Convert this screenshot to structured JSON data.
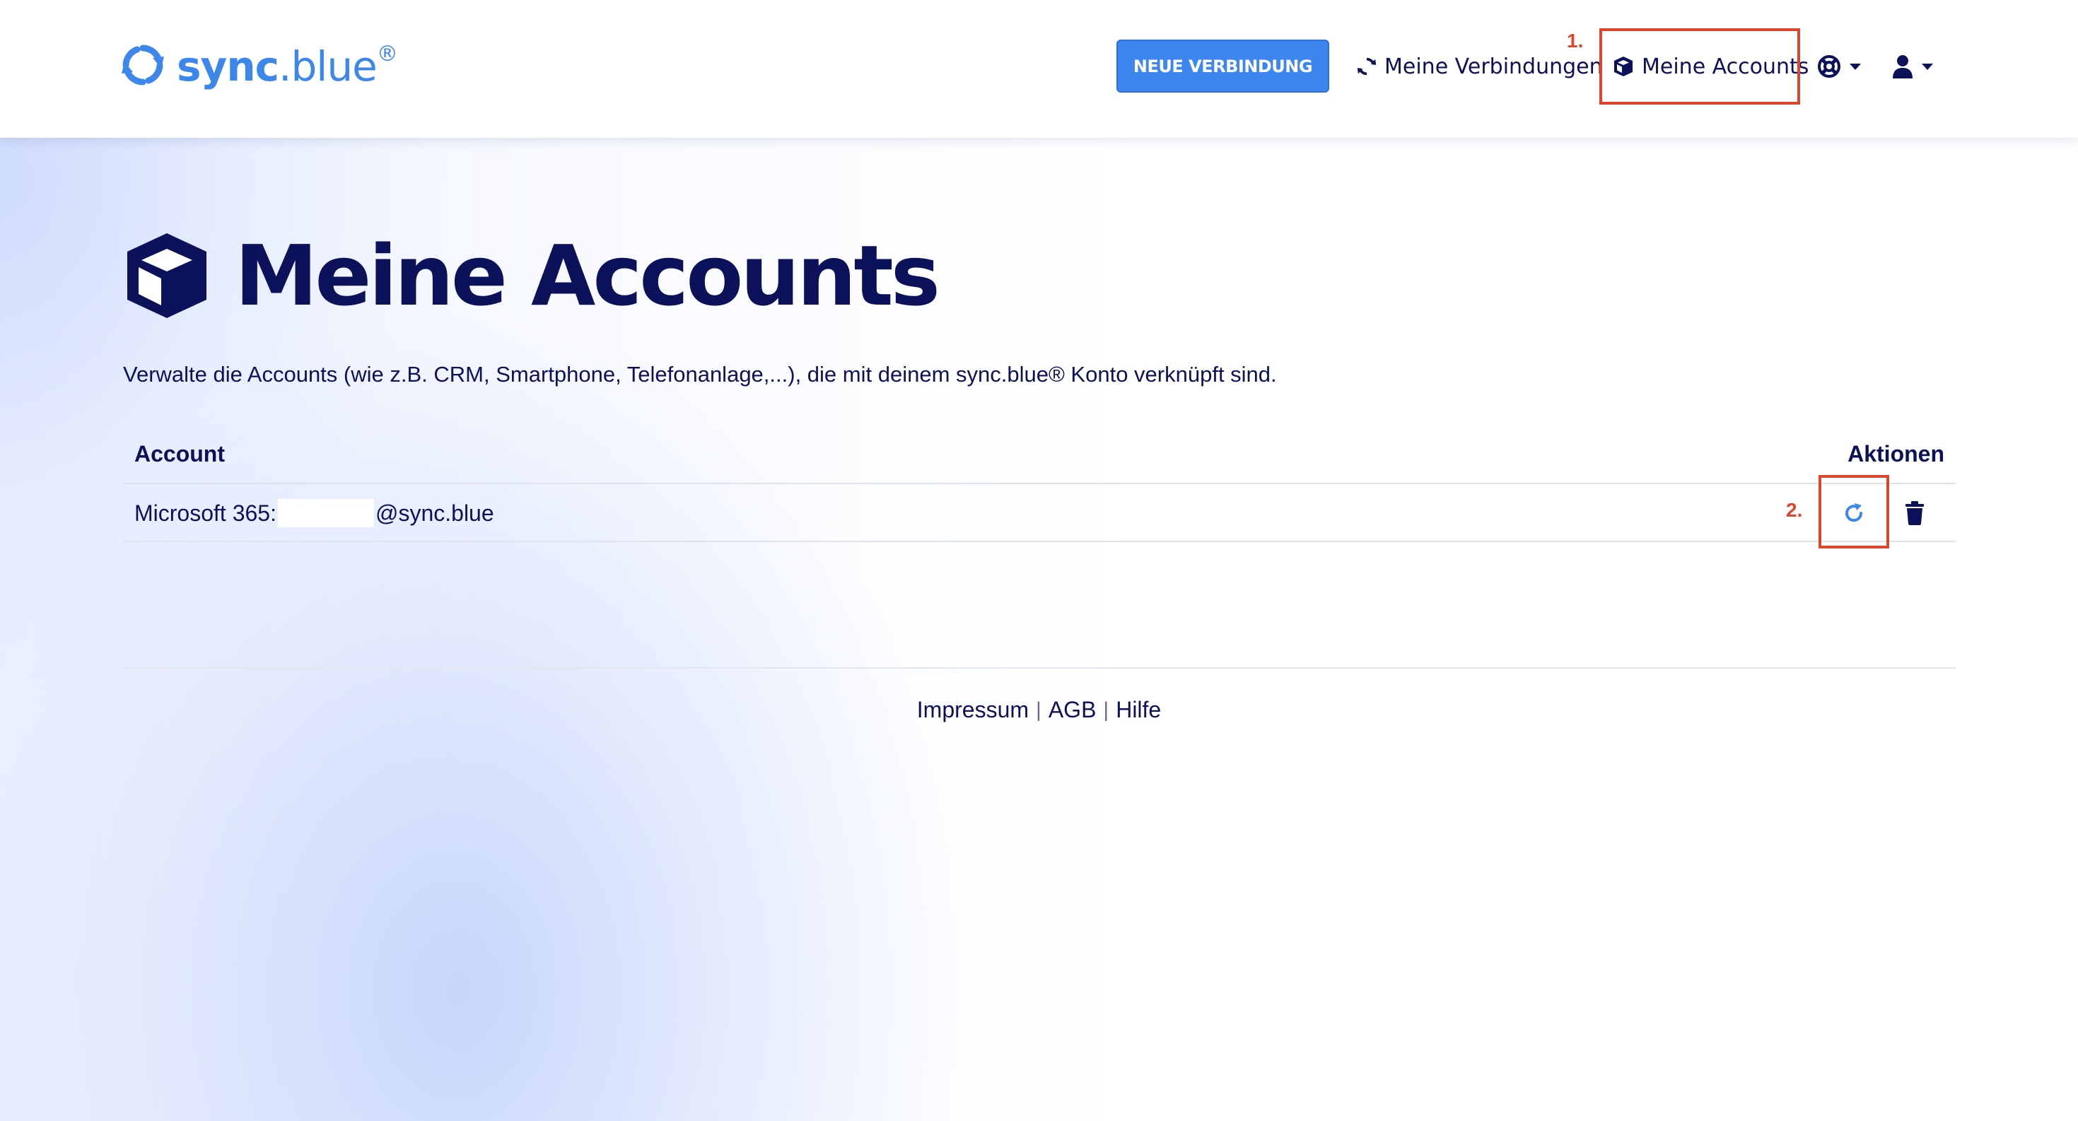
{
  "brand": {
    "name_bold": "sync",
    "name_rest": ".blue",
    "registered": "®",
    "icon": "sync-logo-icon",
    "color": "#3d86ea"
  },
  "navbar": {
    "new_connection_label": "NEUE VERBINDUNG",
    "connections_label": "Meine Verbindungen",
    "accounts_label": "Meine Accounts",
    "help_icon": "lifebuoy-icon",
    "user_icon": "user-icon"
  },
  "annotations": {
    "step1": "1.",
    "step2": "2.",
    "color": "#e0442e"
  },
  "page": {
    "title": "Meine Accounts",
    "title_icon": "cube-icon",
    "description": "Verwalte die Accounts (wie z.B. CRM, Smartphone, Telefonanlage,...), die mit deinem sync.blue® Konto verknüpft sind."
  },
  "table": {
    "headers": {
      "account": "Account",
      "actions": "Aktionen"
    },
    "rows": [
      {
        "account_prefix": "Microsoft 365:",
        "account_suffix": "@sync.blue",
        "actions": [
          "refresh-icon",
          "trash-icon"
        ]
      }
    ]
  },
  "footer": {
    "links": [
      "Impressum",
      "AGB",
      "Hilfe"
    ],
    "separator": "|"
  },
  "colors": {
    "primary_text": "#0b1259",
    "button_bg": "#3d86f0",
    "action_refresh": "#3d86ea"
  }
}
